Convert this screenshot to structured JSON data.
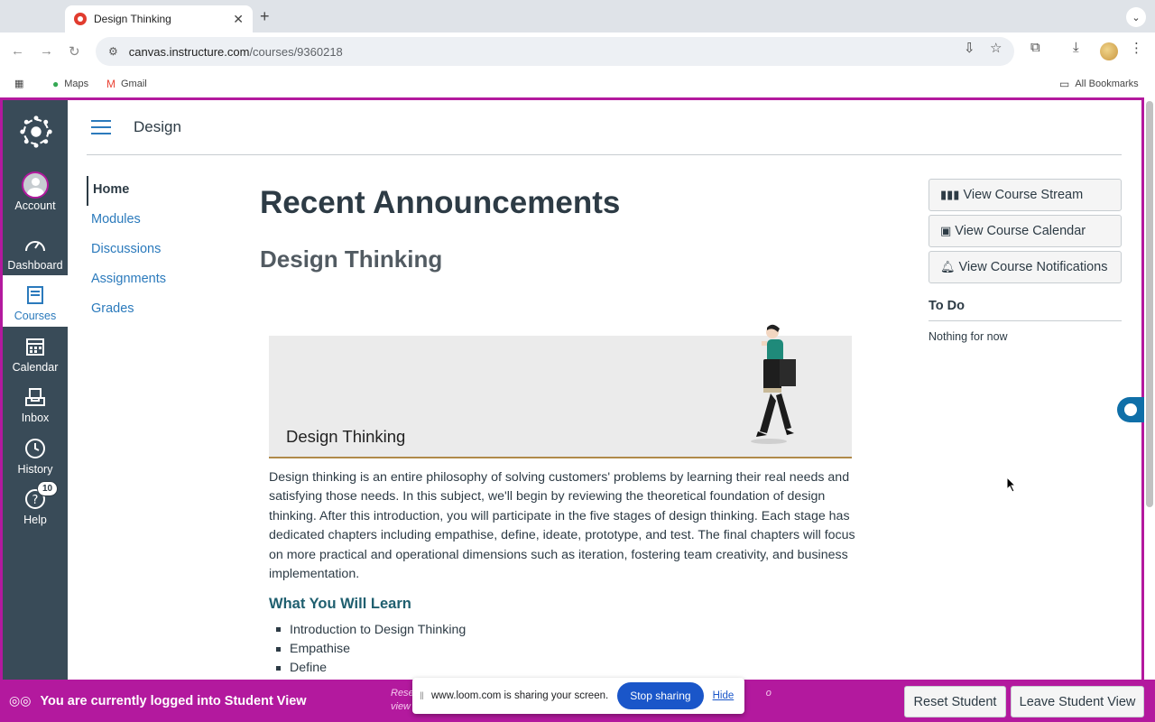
{
  "browser": {
    "tab_title": "Design Thinking",
    "tab_close": "✕",
    "new_tab": "+",
    "url_host": "canvas.instructure.com",
    "url_path": "/courses/9360218",
    "bookmarks": [
      {
        "label": "Maps",
        "icon": "maps-icon"
      },
      {
        "label": "Gmail",
        "icon": "gmail-icon"
      }
    ],
    "all_bookmarks": "All Bookmarks"
  },
  "global_nav": [
    {
      "label": "Account",
      "icon": "account-avatar"
    },
    {
      "label": "Dashboard",
      "icon": "dashboard-icon"
    },
    {
      "label": "Courses",
      "icon": "courses-icon",
      "active": true
    },
    {
      "label": "Calendar",
      "icon": "calendar-icon"
    },
    {
      "label": "Inbox",
      "icon": "inbox-icon"
    },
    {
      "label": "History",
      "icon": "history-icon"
    },
    {
      "label": "Help",
      "icon": "help-icon",
      "badge": "10"
    }
  ],
  "header": {
    "breadcrumb": "Design"
  },
  "course_nav": [
    "Home",
    "Modules",
    "Discussions",
    "Assignments",
    "Grades"
  ],
  "main": {
    "heading": "Recent Announcements",
    "announcement_title": "Design Thinking",
    "banner_title": "Design Thinking",
    "description": "Design thinking is an entire philosophy of solving customers' problems by learning their real needs and satisfying those needs. In this subject, we'll begin by reviewing the theoretical foundation of design thinking. After this introduction, you will participate in the five stages of design thinking. Each stage has dedicated chapters including empathise, define, ideate, prototype, and test. The final chapters will focus on more practical and operational dimensions such as iteration, fostering team creativity, and business implementation.",
    "learn_heading": "What You Will Learn",
    "learn_items": [
      "Introduction to Design Thinking",
      "Empathise",
      "Define"
    ]
  },
  "sidebar": {
    "buttons": [
      {
        "label": "View Course Stream",
        "icon": "stream-icon"
      },
      {
        "label": "View Course Calendar",
        "icon": "calendar-icon"
      },
      {
        "label": "View Course Notifications",
        "icon": "bell-icon"
      }
    ],
    "todo_heading": "To Do",
    "todo_empty": "Nothing for now"
  },
  "student_view": {
    "message": "You are currently logged into Student View",
    "muted_line1": "Rese",
    "muted_line1_end": "o",
    "muted_line2": "view",
    "reset_button": "Reset Student",
    "leave_button": "Leave Student View"
  },
  "screen_share": {
    "message": "www.loom.com is sharing your screen.",
    "stop_label": "Stop sharing",
    "hide_label": "Hide"
  },
  "colors": {
    "student_view_accent": "#b3199e",
    "nav_bg": "#394b58",
    "link": "#2b7abc"
  }
}
